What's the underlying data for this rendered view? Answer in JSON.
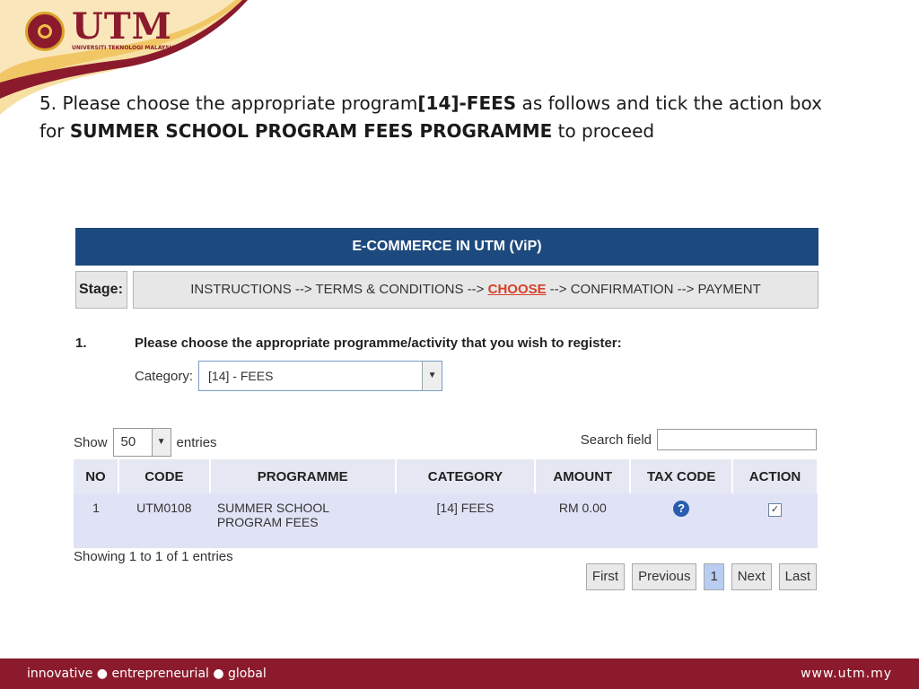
{
  "brand": {
    "logo_word": "UTM",
    "logo_sub": "UNIVERSITI TEKNOLOGI MALAYSIA",
    "accent": "#8b1b2c",
    "gold": "#e8a82b"
  },
  "instruction": {
    "part1": "5. Please choose the appropriate program",
    "bold1": "[14]-FEES",
    "part2": " as follows and tick the action box for ",
    "bold2": "SUMMER SCHOOL PROGRAM FEES PROGRAMME",
    "part3": " to proceed"
  },
  "app": {
    "banner": "E-COMMERCE IN UTM (ViP)",
    "stage_label": "Stage:",
    "stages": {
      "before": "INSTRUCTIONS -->  TERMS & CONDITIONS --> ",
      "current": "CHOOSE",
      "after": " -->  CONFIRMATION -->  PAYMENT"
    },
    "question_number": "1.",
    "question": "Please choose the appropriate programme/activity that you wish to register:",
    "category_label": "Category:",
    "category_value": "[14] - FEES",
    "show_label": "Show",
    "show_value": "50",
    "entries_label": "entries",
    "search_label": "Search field",
    "table": {
      "headers": [
        "NO",
        "CODE",
        "PROGRAMME",
        "CATEGORY",
        "AMOUNT",
        "TAX CODE",
        "ACTION"
      ],
      "rows": [
        {
          "no": "1",
          "code": "UTM0108",
          "programme": "SUMMER SCHOOL PROGRAM FEES",
          "category": "[14] FEES",
          "amount": "RM 0.00",
          "tax_icon": "help-icon",
          "action_checked": true
        }
      ]
    },
    "info": "Showing 1 to 1 of 1 entries",
    "pager": [
      "First",
      "Previous",
      "1",
      "Next",
      "Last"
    ]
  },
  "footer": {
    "tagline": "innovative ● entrepreneurial ● global",
    "url": "www.utm.my"
  }
}
